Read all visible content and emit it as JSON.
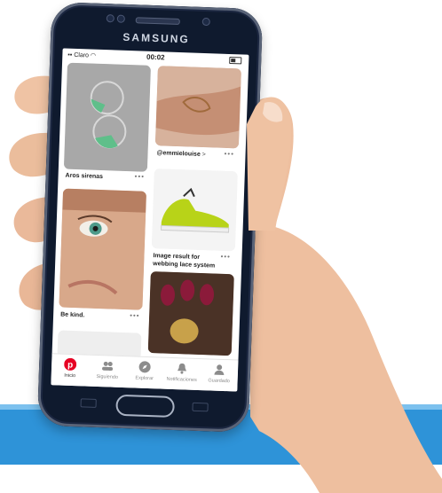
{
  "phone": {
    "brand": "SAMSUNG"
  },
  "status_bar": {
    "carrier": "Claro",
    "time": "00:02"
  },
  "feed": {
    "pins": [
      {
        "caption": "Aros sirenas",
        "more": "•••"
      },
      {
        "caption": "@emmielouise",
        "sub": ">",
        "more": "•••"
      },
      {
        "caption": "Image result for webbing lace system",
        "more": "•••"
      },
      {
        "caption": "Be kind.",
        "more": "•••"
      }
    ]
  },
  "tabbar": {
    "tabs": [
      {
        "label": "Inicio",
        "icon": "pinterest-logo-icon",
        "active": true
      },
      {
        "label": "Siguiendo",
        "icon": "people-icon"
      },
      {
        "label": "Explorar",
        "icon": "compass-icon"
      },
      {
        "label": "Notificaciones",
        "icon": "bell-icon"
      },
      {
        "label": "Guardado",
        "icon": "person-icon"
      }
    ]
  },
  "colors": {
    "accent": "#e60023",
    "banner": "#2e93d8"
  }
}
